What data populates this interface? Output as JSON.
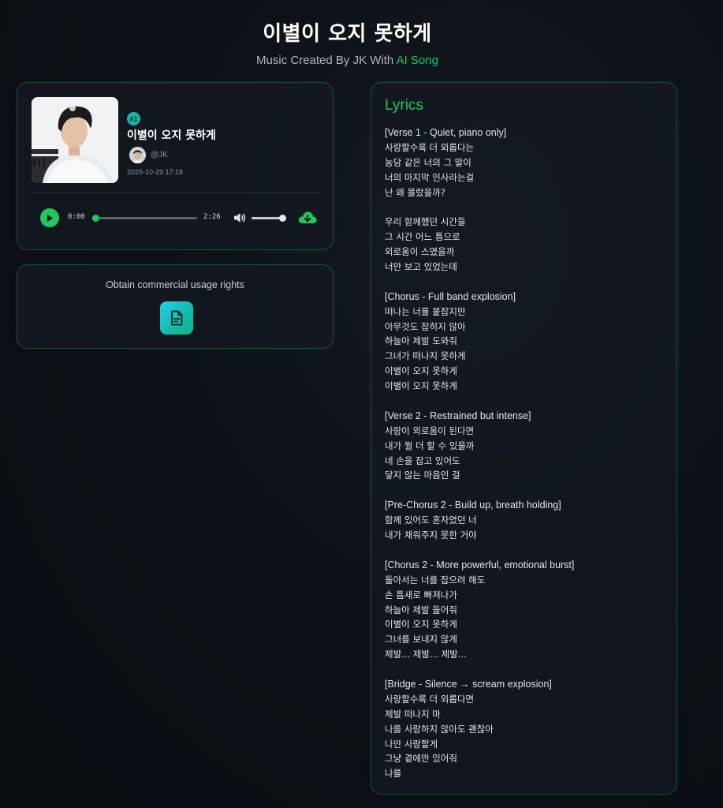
{
  "header": {
    "title": "이별이 오지 못하게",
    "subtitle_prefix": "Music Created By JK With ",
    "subtitle_link": "AI Song"
  },
  "player": {
    "rank_badge": "#1",
    "song_title": "이별이 오지 못하게",
    "artist": "@JK",
    "date": "2025-10-29 17:18",
    "current_time": "0:00",
    "duration": "2:26",
    "progress_fraction": 0.0,
    "volume_fraction": 0.9,
    "icons": {
      "play": "play-icon",
      "volume": "speaker-icon",
      "download": "cloud-download-icon",
      "license": "document-icon"
    }
  },
  "rights": {
    "label": "Obtain commercial usage rights"
  },
  "lyrics": {
    "heading": "Lyrics",
    "lines": [
      "[Verse 1 - Quiet, piano only]",
      "사랑할수록 더 외롭다는",
      "농담 같은 너의 그 말이",
      "너의 마지막 인사라는걸",
      "난 왜 몰랐을까?",
      "",
      "우리 함께했던 시간들",
      "그 시간 어느 틈으로",
      "외로움이 스몄을까",
      "너만 보고 있었는데",
      "",
      "[Chorus - Full band explosion]",
      "떠나는 너를 붙잡지만",
      "아무것도 잡히지 않아",
      "하늘아 제발 도와줘",
      "그녀가 떠나지 못하게",
      "이별이 오지 못하게",
      "이별이 오지 못하게",
      "",
      "[Verse 2 - Restrained but intense]",
      "사랑이 외로움이 된다면",
      "내가 뭘 더 할 수 있을까",
      "네 손을 잡고 있어도",
      "닿지 않는 마음인 걸",
      "",
      "[Pre-Chorus 2 - Build up, breath holding]",
      "함께 있어도 혼자였던 너",
      "내가 채워주지 못한 거야",
      "",
      "[Chorus 2 - More powerful, emotional burst]",
      "돌아서는 너를 잡으려 해도",
      "손 틈새로 빠져나가",
      "하늘아 제발 들어줘",
      "이별이 오지 못하게",
      "그녀를 보내지 않게",
      "제발... 제발... 제발...",
      "",
      "[Bridge - Silence → scream explosion]",
      "사랑할수록 더 외롭다면",
      "제발 떠나지 마",
      "나를 사랑하지 않아도 괜찮아",
      "나만 사랑할게",
      "그냥 곁에만 있어줘",
      "나를"
    ]
  },
  "colors": {
    "accent": "#22c55e",
    "teal": "#14b8a6",
    "background": "#0d1117",
    "card_border": "#1f4a40"
  }
}
